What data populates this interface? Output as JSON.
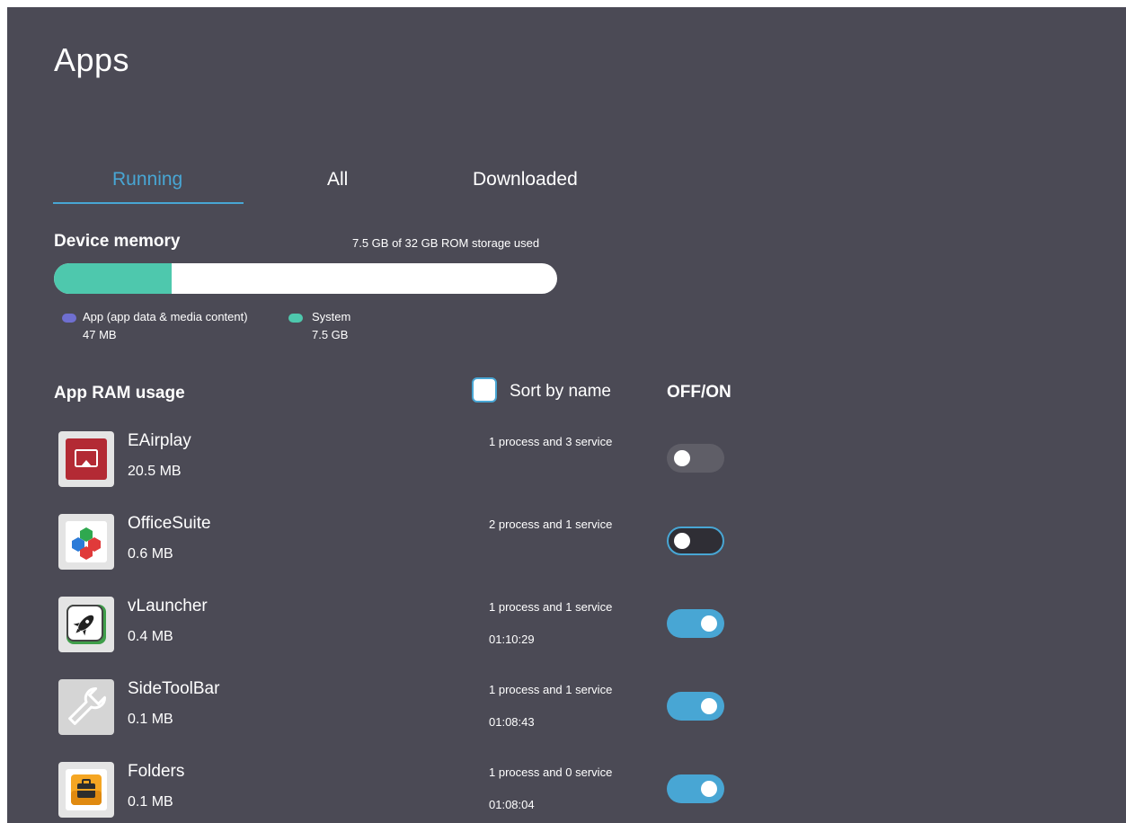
{
  "header": {
    "title": "Apps"
  },
  "tabs": [
    {
      "label": "Running",
      "active": true
    },
    {
      "label": "All",
      "active": false
    },
    {
      "label": "Downloaded",
      "active": false
    }
  ],
  "device_memory": {
    "label": "Device memory",
    "storage_used_text": "7.5 GB of 32 GB ROM storage used",
    "used_fraction": 0.234,
    "legend": [
      {
        "label": "App (app data & media content)",
        "value": "47 MB",
        "color": "#6f6fd0"
      },
      {
        "label": "System",
        "value": "7.5 GB",
        "color": "#4ec8ad"
      }
    ]
  },
  "ram_usage": {
    "label": "App RAM usage",
    "sort_label": "Sort by name",
    "sort_checked": false,
    "offon_label": "OFF/ON"
  },
  "apps": [
    {
      "name": "EAirplay",
      "size": "20.5 MB",
      "processes": "1 process and 3 service",
      "time": "",
      "enabled": false,
      "icon": "eairplay-icon"
    },
    {
      "name": "OfficeSuite",
      "size": "0.6 MB",
      "processes": "2 process and 1 service",
      "time": "",
      "enabled": false,
      "icon": "officesuite-icon"
    },
    {
      "name": "vLauncher",
      "size": "0.4 MB",
      "processes": "1 process and 1 service",
      "time": "01:10:29",
      "enabled": true,
      "icon": "rocket-icon"
    },
    {
      "name": "SideToolBar",
      "size": "0.1 MB",
      "processes": "1 process and 1 service",
      "time": "01:08:43",
      "enabled": true,
      "icon": "wrench-icon"
    },
    {
      "name": "Folders",
      "size": "0.1 MB",
      "processes": "1 process and 0 service",
      "time": "01:08:04",
      "enabled": true,
      "icon": "briefcase-icon"
    }
  ],
  "colors": {
    "background": "#4b4a55",
    "accent": "#48a6d4",
    "system": "#4ec8ad",
    "app": "#6f6fd0"
  }
}
